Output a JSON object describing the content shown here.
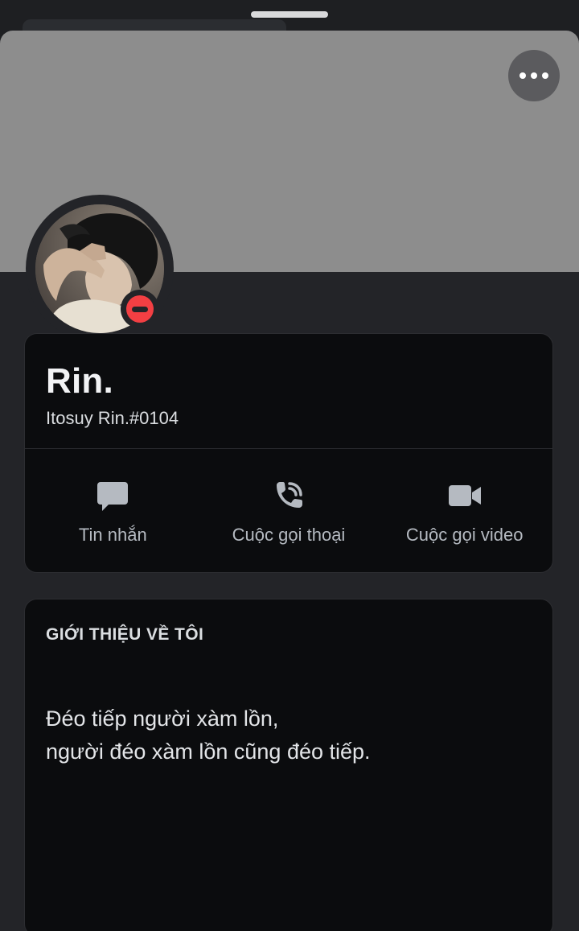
{
  "profile": {
    "display_name": "Rin.",
    "username": "Itosuy Rin.#0104",
    "status": "do-not-disturb"
  },
  "actions": [
    {
      "label": "Tin nhắn",
      "icon": "message-icon"
    },
    {
      "label": "Cuộc gọi thoại",
      "icon": "voice-call-icon"
    },
    {
      "label": "Cuộc gọi video",
      "icon": "video-call-icon"
    }
  ],
  "about": {
    "heading": "GIỚI THIỆU VỀ TÔI",
    "lines": [
      "Đéo tiếp người xàm lồn,",
      "người đéo xàm lồn cũng đéo tiếp."
    ]
  },
  "colors": {
    "banner": "#8d8d8d",
    "status_dnd": "#f23f43",
    "card_bg": "#0b0c0e",
    "sheet_bg": "#232428"
  }
}
